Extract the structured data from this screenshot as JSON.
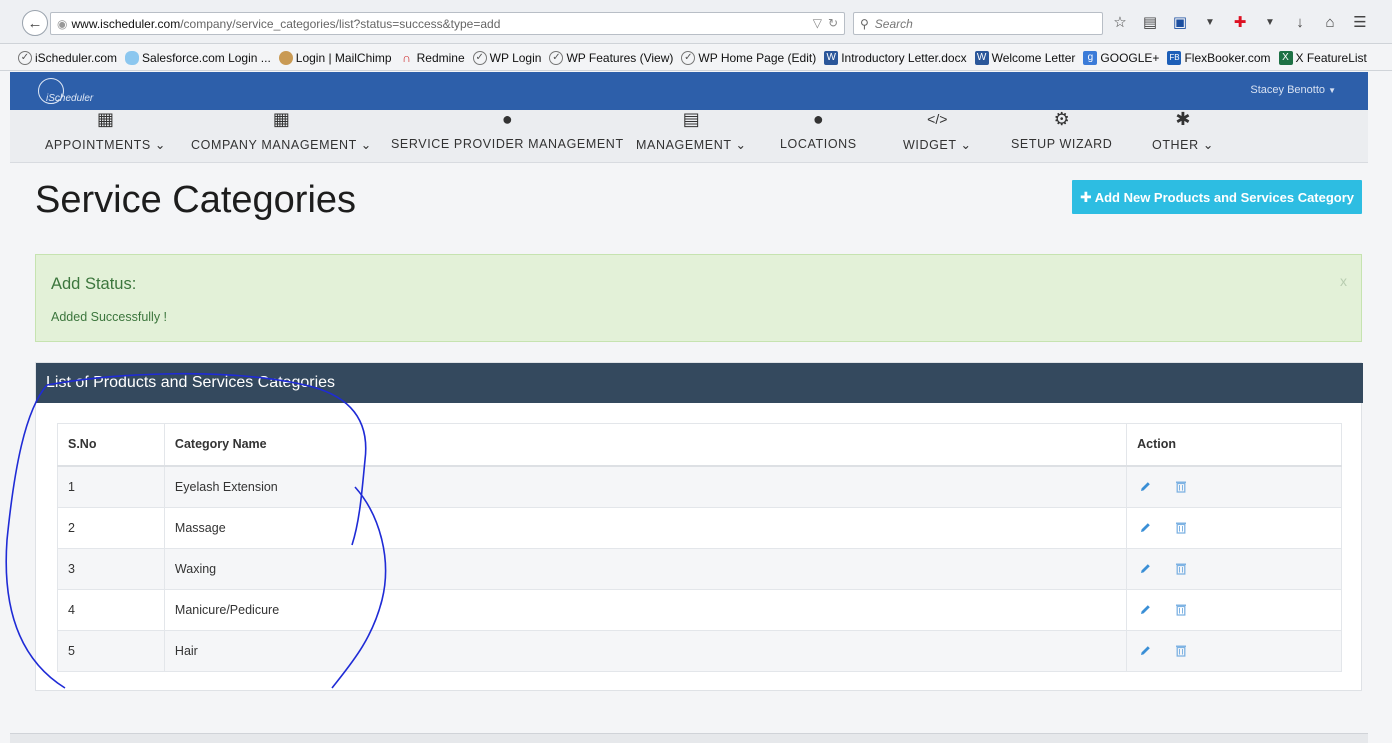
{
  "browser": {
    "url_domain": "www.ischeduler.com",
    "url_path": "/company/service_categories/list?status=success&type=add",
    "url_prefix": "www.",
    "search_placeholder": "Search"
  },
  "bookmarks": [
    {
      "label": "iScheduler.com",
      "icon": "clock-icon"
    },
    {
      "label": "Salesforce.com Login ...",
      "icon": "cloud-icon"
    },
    {
      "label": "Login | MailChimp",
      "icon": "monkey-icon"
    },
    {
      "label": "Redmine",
      "icon": "redmine-icon"
    },
    {
      "label": "WP Login",
      "icon": "clock-icon"
    },
    {
      "label": "WP Features (View)",
      "icon": "clock-icon"
    },
    {
      "label": "WP Home Page (Edit)",
      "icon": "clock-icon"
    },
    {
      "label": "Introductory Letter.docx",
      "icon": "word-icon"
    },
    {
      "label": "Welcome Letter",
      "icon": "word-icon"
    },
    {
      "label": "GOOGLE+",
      "icon": "google-icon"
    },
    {
      "label": "FlexBooker.com",
      "icon": "flexbooker-icon"
    },
    {
      "label": "X FeatureList",
      "icon": "excel-icon"
    }
  ],
  "app": {
    "logo_text": "iScheduler",
    "user_name": "Stacey Benotto",
    "brand_color": "#2d5faa"
  },
  "nav": [
    {
      "label": "APPOINTMENTS",
      "caret": "⌄"
    },
    {
      "label": "COMPANY MANAGEMENT",
      "caret": "⌄"
    },
    {
      "label": "SERVICE PROVIDER MANAGEMENT",
      "caret": ""
    },
    {
      "label": "MANAGEMENT",
      "caret": "⌄"
    },
    {
      "label": "LOCATIONS",
      "caret": ""
    },
    {
      "label": "WIDGET",
      "caret": "⌄"
    },
    {
      "label": "SETUP WIZARD",
      "caret": ""
    },
    {
      "label": "OTHER",
      "caret": "⌄"
    }
  ],
  "page": {
    "title": "Service Categories",
    "add_button": "Add New Products and Services Category",
    "alert_title": "Add Status:",
    "alert_message": "Added Successfully !",
    "alert_close": "x",
    "panel_title": "List of Products and Services Categories"
  },
  "table": {
    "headers": [
      "S.No",
      "Category Name",
      "Action"
    ],
    "rows": [
      {
        "sno": "1",
        "name": "Eyelash Extension"
      },
      {
        "sno": "2",
        "name": "Massage"
      },
      {
        "sno": "3",
        "name": "Waxing"
      },
      {
        "sno": "4",
        "name": "Manicure/Pedicure"
      },
      {
        "sno": "5",
        "name": "Hair"
      }
    ]
  },
  "colors": {
    "add_button": "#2dbde2",
    "panel_header": "#34495e",
    "success_bg": "#e3f1d8",
    "success_text": "#3c763d",
    "action_icon": "#3a8fd6",
    "annotation_ink": "#1f2bd6"
  }
}
